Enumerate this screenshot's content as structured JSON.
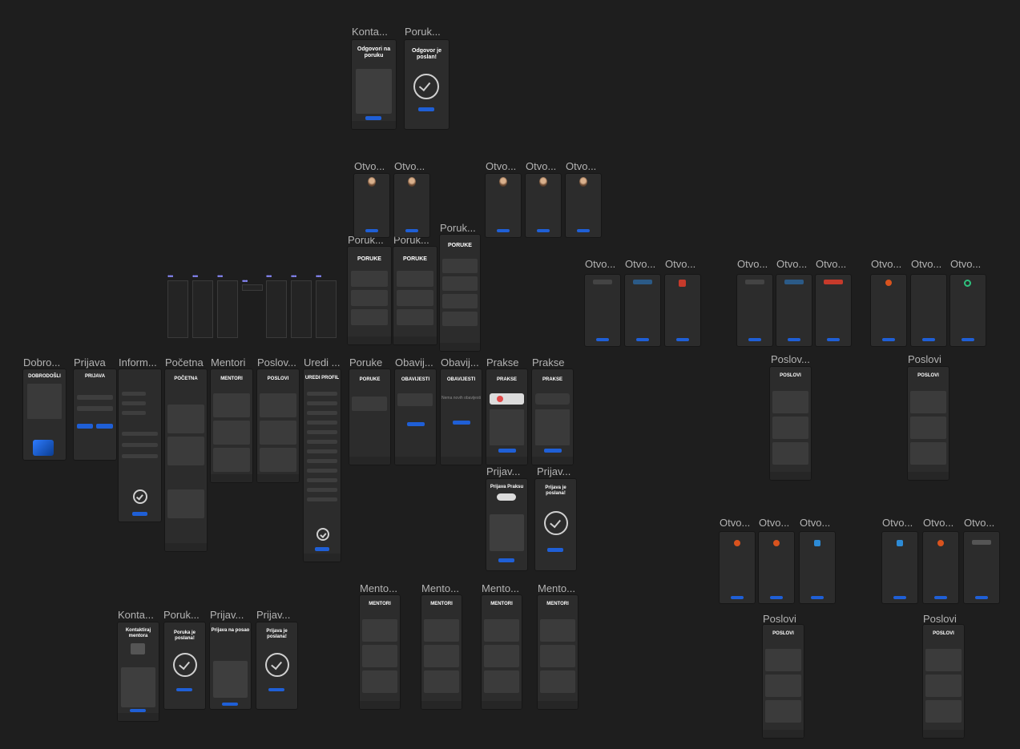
{
  "canvas_background": "#1e1e1e",
  "accent_color": "#1f5fd6",
  "frame_labels": {
    "kontakt_top": "Konta...",
    "poruka_top": "Poruk...",
    "otvo_a1": "Otvo...",
    "otvo_a2": "Otvo...",
    "otvo_b1": "Otvo...",
    "otvo_b2": "Otvo...",
    "otvo_b3": "Otvo...",
    "poruk_c": "Poruk...",
    "poruk_d1": "Poruk...",
    "poruk_d2": "Poruk...",
    "otvo_e1": "Otvo...",
    "otvo_e2": "Otvo...",
    "otvo_e3": "Otvo...",
    "otvo_f1": "Otvo...",
    "otvo_f2": "Otvo...",
    "otvo_f3": "Otvo...",
    "otvo_g1": "Otvo...",
    "otvo_g2": "Otvo...",
    "otvo_g3": "Otvo...",
    "dobro": "Dobro...",
    "prijava": "Prijava",
    "inform": "Inform...",
    "pocetna": "Početna",
    "mentori": "Mentori",
    "poslov": "Poslov...",
    "uredi": "Uredi ...",
    "poruke": "Poruke",
    "obavij1": "Obavij...",
    "obavij2": "Obavij...",
    "prakse1": "Prakse",
    "prakse2": "Prakse",
    "poslov_h1": "Poslov...",
    "poslovi_h2": "Poslovi",
    "prijav_i1": "Prijav...",
    "prijav_i2": "Prijav...",
    "otvo_j1": "Otvo...",
    "otvo_j2": "Otvo...",
    "otvo_j3": "Otvo...",
    "otvo_k1": "Otvo...",
    "otvo_k2": "Otvo...",
    "otvo_k3": "Otvo...",
    "mento1": "Mento...",
    "mento2": "Mento...",
    "mento3": "Mento...",
    "mento4": "Mento...",
    "poslovi_l1": "Poslovi",
    "poslovi_l2": "Poslovi",
    "konta_m": "Konta...",
    "poruk_m": "Poruk...",
    "prijav_m1": "Prijav...",
    "prijav_m2": "Prijav..."
  },
  "screens": {
    "odgovori": "Odgovori na poruku",
    "odgovor_poslan": "Odgovor je poslan!",
    "poruke": "PORUKE",
    "dobrodosli": "DOBRODOŠLI",
    "prijava": "PRIJAVA",
    "pocetna": "POČETNA",
    "mentori": "MENTORI",
    "poslovi": "POSLOVI",
    "uredi_profil": "UREDI PROFIL",
    "obavijesti": "OBAVIJESTI",
    "nema_obavijesti": "Nema novih obavijesti",
    "prakse": "PRAKSE",
    "prijava_praksu": "Prijava Praksu",
    "prijava_poslana": "Prijava je poslana!",
    "kontaktiraj": "Kontaktiraj mentora",
    "poruka_poslana": "Poruka je poslana!",
    "prijava_posao": "Prijava na posao",
    "span": "span"
  }
}
